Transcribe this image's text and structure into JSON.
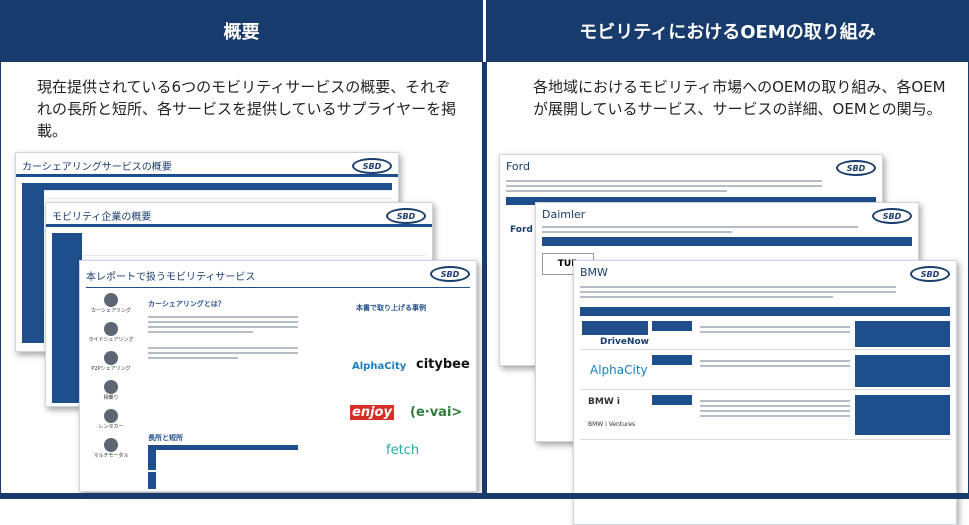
{
  "left": {
    "header": "概要",
    "description": "現在提供されている6つのモビリティサービスの概要、それぞれの長所と短所、各サービスを提供しているサプライヤーを掲載。",
    "slides": {
      "car_sharing_title": "カーシェアリングサービスの概要",
      "mobility_companies_title": "モビリティ企業の概要",
      "services_title": "本レポートで扱うモビリティサービス",
      "car_sharing_question": "カーシェアリングとは？",
      "pros_cons_label": "長所と短所",
      "featured_examples_label": "本書で取り上げる事例",
      "sidebar_items": [
        "カーシェアリング",
        "ライドシェアリング",
        "P2Pシェアリング",
        "相乗り",
        "レンタカー",
        "マルチモーダル"
      ],
      "logos": {
        "alphacity": "AlphaCity",
        "citybee": "citybee",
        "enjoy": "enjoy",
        "evai": "(e·vai>",
        "fetch": "fetch"
      },
      "sbd_logo": "SBD"
    }
  },
  "right": {
    "header": "モビリティにおけるOEMの取り組み",
    "description": "各地域におけるモビリティ市場へのOEMの取り組み、各OEMが展開しているサービス、サービスの詳細、OEMとの関与。",
    "slides": {
      "ford": "Ford",
      "daimler": "Daimler",
      "bmw": "BMW",
      "drivenow": "DriveNow",
      "alphacity": "AlphaCity",
      "bmw_ventures": "BMW i Ventures",
      "sbd_logo": "SBD"
    }
  },
  "colors": {
    "brand_navy": "#173b6c",
    "slide_blue": "#1f4e8c"
  }
}
